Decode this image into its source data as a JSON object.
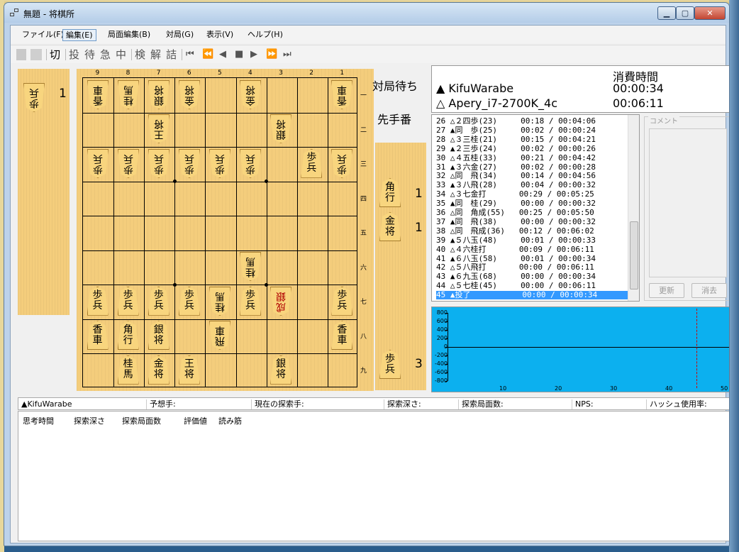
{
  "window": {
    "title": "無題 - 将棋所",
    "min_label": "▁",
    "max_label": "▢",
    "close_label": "✕"
  },
  "menu": {
    "file": "ファイル(F)",
    "edit": "編集(E)",
    "position_edit": "局面編集(B)",
    "game": "対局(G)",
    "view": "表示(V)",
    "help": "ヘルプ(H)"
  },
  "toolbar": {
    "cut": "切",
    "resign": "投",
    "wait": "待",
    "hurry": "急",
    "abort": "中",
    "review": "検",
    "analyze": "解",
    "tsume": "詰",
    "first": "⏮",
    "prev10": "⏪",
    "prev": "◀",
    "stop": "■",
    "next": "▶",
    "next10": "⏩",
    "last": "⏭"
  },
  "board": {
    "files": [
      "9",
      "8",
      "7",
      "6",
      "5",
      "4",
      "3",
      "2",
      "1"
    ],
    "ranks": [
      "一",
      "二",
      "三",
      "四",
      "五",
      "六",
      "七",
      "八",
      "九"
    ],
    "pieces": [
      {
        "f": 9,
        "r": 1,
        "t": "香車",
        "gote": true
      },
      {
        "f": 8,
        "r": 1,
        "t": "桂馬",
        "gote": true
      },
      {
        "f": 7,
        "r": 1,
        "t": "銀将",
        "gote": true
      },
      {
        "f": 6,
        "r": 1,
        "t": "金将",
        "gote": true
      },
      {
        "f": 4,
        "r": 1,
        "t": "金将",
        "gote": true
      },
      {
        "f": 1,
        "r": 1,
        "t": "香車",
        "gote": true
      },
      {
        "f": 7,
        "r": 2,
        "t": "王将",
        "gote": true
      },
      {
        "f": 3,
        "r": 2,
        "t": "銀将",
        "gote": true
      },
      {
        "f": 9,
        "r": 3,
        "t": "歩兵",
        "gote": true
      },
      {
        "f": 8,
        "r": 3,
        "t": "歩兵",
        "gote": true
      },
      {
        "f": 7,
        "r": 3,
        "t": "歩兵",
        "gote": true
      },
      {
        "f": 6,
        "r": 3,
        "t": "歩兵",
        "gote": true
      },
      {
        "f": 5,
        "r": 3,
        "t": "歩兵",
        "gote": true
      },
      {
        "f": 4,
        "r": 3,
        "t": "歩兵",
        "gote": true
      },
      {
        "f": 2,
        "r": 3,
        "t": "歩兵",
        "gote": false
      },
      {
        "f": 1,
        "r": 3,
        "t": "歩兵",
        "gote": true
      },
      {
        "f": 4,
        "r": 6,
        "t": "桂馬",
        "gote": true
      },
      {
        "f": 9,
        "r": 7,
        "t": "歩兵",
        "gote": false
      },
      {
        "f": 8,
        "r": 7,
        "t": "歩兵",
        "gote": false
      },
      {
        "f": 7,
        "r": 7,
        "t": "歩兵",
        "gote": false
      },
      {
        "f": 6,
        "r": 7,
        "t": "歩兵",
        "gote": false
      },
      {
        "f": 5,
        "r": 7,
        "t": "桂馬",
        "gote": true
      },
      {
        "f": 4,
        "r": 7,
        "t": "歩兵",
        "gote": false
      },
      {
        "f": 3,
        "r": 7,
        "t": "成銀",
        "gote": true,
        "red": true
      },
      {
        "f": 1,
        "r": 7,
        "t": "歩兵",
        "gote": false
      },
      {
        "f": 9,
        "r": 8,
        "t": "香車",
        "gote": false
      },
      {
        "f": 8,
        "r": 8,
        "t": "角行",
        "gote": false
      },
      {
        "f": 7,
        "r": 8,
        "t": "銀将",
        "gote": false
      },
      {
        "f": 5,
        "r": 8,
        "t": "飛車",
        "gote": true
      },
      {
        "f": 1,
        "r": 8,
        "t": "香車",
        "gote": false
      },
      {
        "f": 8,
        "r": 9,
        "t": "桂馬",
        "gote": false
      },
      {
        "f": 7,
        "r": 9,
        "t": "金将",
        "gote": false
      },
      {
        "f": 6,
        "r": 9,
        "t": "王将",
        "gote": false
      },
      {
        "f": 3,
        "r": 9,
        "t": "銀将",
        "gote": false
      }
    ]
  },
  "gote_hand": {
    "piece": "歩兵",
    "count": "1"
  },
  "sente_hand": [
    {
      "piece": "角行",
      "count": "1"
    },
    {
      "piece": "金将",
      "count": "1"
    },
    {
      "piece": "歩兵",
      "count": "3"
    }
  ],
  "status": {
    "waiting": "対局待ち",
    "turn": "先手番"
  },
  "players": {
    "header": "消費時間",
    "sente": {
      "mark": "▲",
      "name": "KifuWarabe",
      "time": "00:00:34"
    },
    "gote": {
      "mark": "△",
      "name": "Apery_i7-2700K_4c",
      "time": "00:06:11"
    }
  },
  "kifu": [
    "26 △２四歩(23)     00:18 / 00:04:06",
    "27 ▲同　歩(25)     00:02 / 00:00:24",
    "28 △３三桂(21)     00:15 / 00:04:21",
    "29 ▲２三歩(24)     00:02 / 00:00:26",
    "30 △４五桂(33)     00:21 / 00:04:42",
    "31 ▲３六金(27)     00:02 / 00:00:28",
    "32 △同　飛(34)     00:14 / 00:04:56",
    "33 ▲３八飛(28)     00:04 / 00:00:32",
    "34 △３七金打       00:29 / 00:05:25",
    "35 ▲同　桂(29)     00:00 / 00:00:32",
    "36 △同　角成(55)   00:25 / 00:05:50",
    "37 ▲同　飛(38)     00:00 / 00:00:32",
    "38 △同　飛成(36)   00:12 / 00:06:02",
    "39 ▲５八玉(48)     00:01 / 00:00:33",
    "40 △４六桂打       00:09 / 00:06:11",
    "41 ▲６八玉(58)     00:01 / 00:00:34",
    "42 △５八飛打       00:00 / 00:06:11",
    "43 ▲６九玉(68)     00:00 / 00:00:34",
    "44 △５七桂(45)     00:00 / 00:06:11",
    "45 ▲投了           00:00 / 00:00:34"
  ],
  "selected_move": 19,
  "comment": {
    "label": "コメント",
    "update": "更新",
    "clear": "消去"
  },
  "eval_graph": {
    "y_labels": [
      "800",
      "600",
      "400",
      "200",
      "0",
      "-200",
      "-400",
      "-600",
      "-800"
    ],
    "x_labels": [
      "10",
      "20",
      "30",
      "40",
      "50"
    ],
    "bg_color": "#0cb0ef"
  },
  "engine": {
    "player": "▲KifuWarabe",
    "predicted": "予想手:",
    "current": "現在の探索手:",
    "depth": "探索深さ:",
    "nodes": "探索局面数:",
    "nps": "NPS:",
    "hash": "ハッシュ使用率:"
  },
  "pv_headers": {
    "time": "思考時間",
    "depth": "探索深さ",
    "nodes": "探索局面数",
    "eval": "評価値",
    "pv": "読み筋"
  }
}
